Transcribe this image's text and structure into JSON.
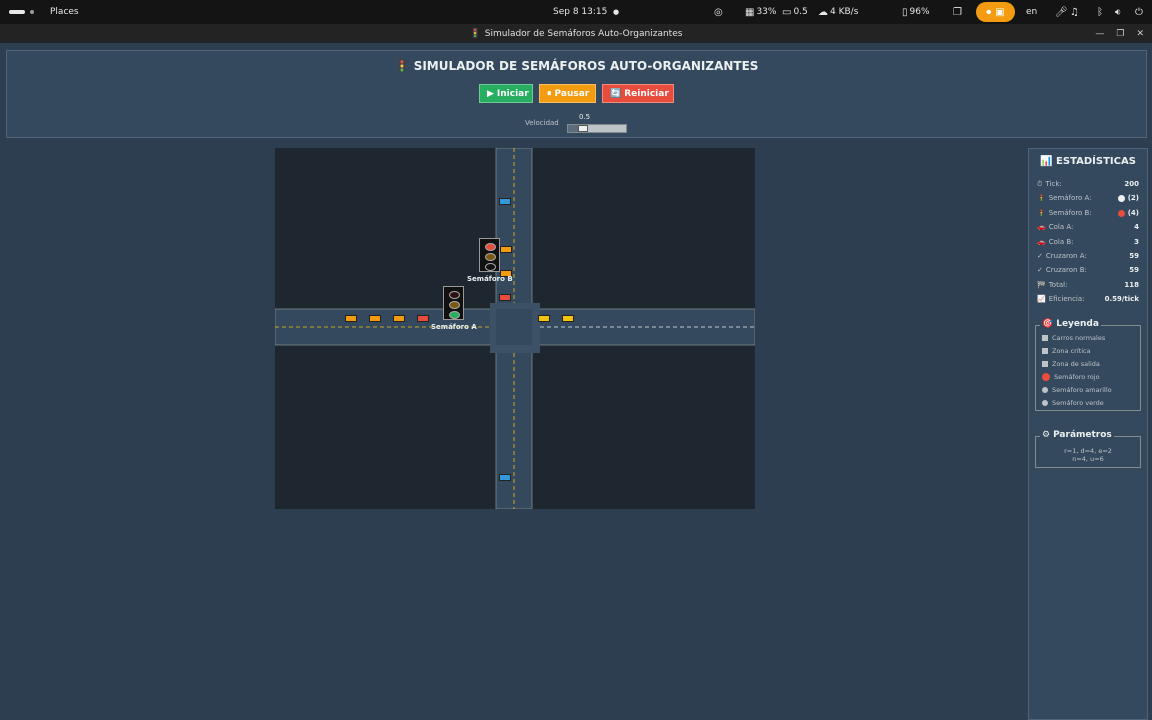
{
  "topbar": {
    "activities": "Places",
    "datetime": "Sep 8  13:15",
    "battery_pct": "33%",
    "load": "0.5",
    "net_speed": "4 KB/s",
    "volume_pct": "96%",
    "language": "en"
  },
  "window": {
    "title": "Simulador de Semáforos Auto-Organizantes",
    "title_icon": "traffic-light-icon"
  },
  "header": {
    "title": "SIMULADOR DE SEMÁFOROS AUTO-ORGANIZANTES",
    "buttons": {
      "start": {
        "icon": "▶",
        "label": "Iniciar"
      },
      "pause": {
        "icon": "⏸",
        "label": "Pausar"
      },
      "reset": {
        "icon": "🔄",
        "label": "Reiniciar"
      }
    },
    "speed_label": "Velocidad",
    "speed_value": "0.5",
    "speed_fraction": 0.2
  },
  "simulation": {
    "traffic_light_a": {
      "label": "Semáforo A",
      "state": "green"
    },
    "traffic_light_b": {
      "label": "Semáforo B",
      "state": "red"
    },
    "colors": {
      "road": "#34495e",
      "background": "#1e2630",
      "lane_line": "#f1c40f",
      "car_orange": "#f39c12",
      "car_red": "#e74c3c",
      "car_blue": "#3498db",
      "car_yellow": "#f1c40f"
    }
  },
  "stats": {
    "title": "ESTADÍSTICAS",
    "title_icon": "bar-chart-icon",
    "tick": {
      "label": "Tick:",
      "value": "200"
    },
    "light_a": {
      "label": "Semáforo A:",
      "count": "(2)",
      "color": "#ecf0f1"
    },
    "light_b": {
      "label": "Semáforo B:",
      "count": "(4)",
      "color": "#e74c3c"
    },
    "queue_a": {
      "label": "Cola A:",
      "value": "4"
    },
    "queue_b": {
      "label": "Cola B:",
      "value": "3"
    },
    "crossed_a": {
      "label": "Cruzaron A:",
      "value": "59"
    },
    "crossed_b": {
      "label": "Cruzaron B:",
      "value": "59"
    },
    "total": {
      "label": "Total:",
      "value": "118"
    },
    "efficiency": {
      "label": "Eficiencia:",
      "value": "0.59/tick"
    }
  },
  "legend": {
    "title": "Leyenda",
    "items": [
      {
        "label": "Carros normales",
        "color": "#bdc3c7"
      },
      {
        "label": "Zona crítica",
        "color": "#bdc3c7"
      },
      {
        "label": "Zona de salida",
        "color": "#bdc3c7"
      },
      {
        "label": "Semáforo rojo",
        "color": "#e74c3c"
      },
      {
        "label": "Semáforo amarillo",
        "color": "#bdc3c7"
      },
      {
        "label": "Semáforo verde",
        "color": "#bdc3c7"
      }
    ]
  },
  "params": {
    "title": "Parámetros",
    "line1": "r=1, d=4, e=2",
    "line2": "n=4, u=6"
  }
}
